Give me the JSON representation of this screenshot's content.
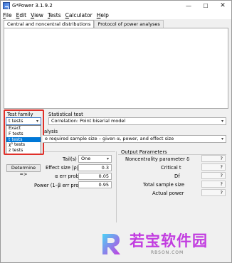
{
  "window": {
    "title": "G*Power 3.1.9.2",
    "minimize": "—",
    "maximize": "☐",
    "close": "✕"
  },
  "menu": {
    "items": [
      {
        "label": "File",
        "u": "F",
        "rest": "ile"
      },
      {
        "label": "Edit",
        "u": "E",
        "rest": "dit"
      },
      {
        "label": "View",
        "u": "V",
        "rest": "iew"
      },
      {
        "label": "Tests",
        "u": "T",
        "rest": "ests"
      },
      {
        "label": "Calculator",
        "u": "C",
        "rest": "alculator"
      },
      {
        "label": "Help",
        "u": "H",
        "rest": "elp"
      }
    ]
  },
  "tabs": [
    {
      "label": "Central and noncentral distributions",
      "active": true
    },
    {
      "label": "Protocol of power analyses",
      "active": false
    }
  ],
  "test_family": {
    "label": "Test family",
    "selected": "t tests",
    "options": [
      "Exact",
      "F tests",
      "t tests",
      "χ² tests",
      "z tests"
    ],
    "highlighted_index": 2
  },
  "statistical_test": {
    "label": "Statistical test",
    "selected": "Correlation: Point biserial model"
  },
  "analysis": {
    "label": "alysis",
    "selected": "e required sample size – given α, power, and effect size"
  },
  "input": {
    "tails_label": "Tail(s)",
    "tails_value": "One",
    "determine_label": "Determine =>",
    "effect_size_label": "Effect size |ρ|",
    "effect_size_value": "0.3",
    "alpha_label": "α err prob",
    "alpha_value": "0.05",
    "power_label": "Power (1–β err prob)",
    "power_value": "0.95"
  },
  "output": {
    "header": "Output Parameters",
    "rows": [
      {
        "label": "Noncentrality parameter δ",
        "value": "?"
      },
      {
        "label": "Critical t",
        "value": "?"
      },
      {
        "label": "Df",
        "value": "?"
      },
      {
        "label": "Total sample size",
        "value": "?"
      },
      {
        "label": "Actual power",
        "value": "?"
      }
    ]
  },
  "watermark": {
    "main": "若宝软件园",
    "sub": "RBSON.COM",
    "accent": "#c23de0"
  }
}
